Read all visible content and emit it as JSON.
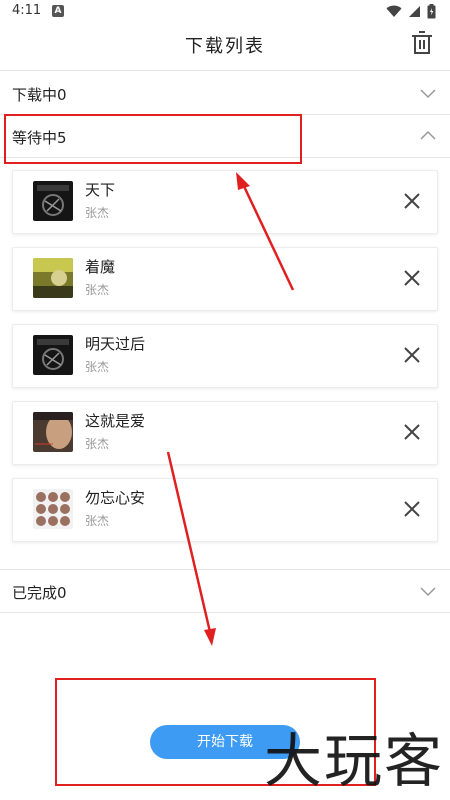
{
  "status_bar": {
    "time": "4:11",
    "notif_letter": "A"
  },
  "header": {
    "title": "下载列表"
  },
  "sections": {
    "downloading": {
      "label": "下载中0"
    },
    "waiting": {
      "label": "等待中5"
    },
    "completed": {
      "label": "已完成0"
    }
  },
  "waiting_items": [
    {
      "title": "天下",
      "artist": "张杰"
    },
    {
      "title": "着魔",
      "artist": "张杰"
    },
    {
      "title": "明天过后",
      "artist": "张杰"
    },
    {
      "title": "这就是爱",
      "artist": "张杰"
    },
    {
      "title": "勿忘心安",
      "artist": "张杰"
    }
  ],
  "actions": {
    "start_label": "开始下载"
  },
  "watermark": {
    "text": "大玩客"
  },
  "colors": {
    "accent": "#3d9bf3",
    "annotation": "#e02020"
  }
}
